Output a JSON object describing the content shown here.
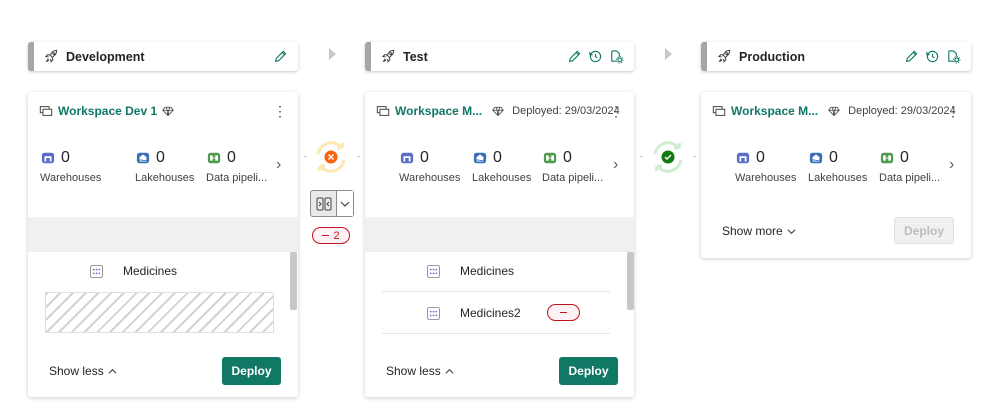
{
  "stages": [
    {
      "title": "Development"
    },
    {
      "title": "Test"
    },
    {
      "title": "Production"
    }
  ],
  "dev": {
    "workspace": "Workspace Dev 1",
    "metrics": [
      {
        "value": "0",
        "label": "Warehouses"
      },
      {
        "value": "0",
        "label": "Lakehouses"
      },
      {
        "value": "0",
        "label": "Data pipeli..."
      }
    ],
    "items": [
      "Medicines"
    ],
    "show_label": "Show less",
    "deploy_label": "Deploy"
  },
  "test": {
    "workspace": "Workspace M...",
    "deployed": "Deployed: 29/03/2024",
    "metrics": [
      {
        "value": "0",
        "label": "Warehouses"
      },
      {
        "value": "0",
        "label": "Lakehouses"
      },
      {
        "value": "0",
        "label": "Data pipeli..."
      }
    ],
    "items": [
      "Medicines",
      "Medicines2"
    ],
    "show_label": "Show less",
    "deploy_label": "Deploy"
  },
  "prod": {
    "workspace": "Workspace M...",
    "deployed": "Deployed: 29/03/2024",
    "metrics": [
      {
        "value": "0",
        "label": "Warehouses"
      },
      {
        "value": "0",
        "label": "Lakehouses"
      },
      {
        "value": "0",
        "label": "Data pipeli..."
      }
    ],
    "show_label": "Show more",
    "deploy_label": "Deploy"
  },
  "compare": {
    "diff_count": "2"
  },
  "colors": {
    "accent": "#117865",
    "diff": "#c50f1f",
    "warn": "#f7630c",
    "ok": "#107c10"
  },
  "icons": [
    "rocket-icon",
    "pencil-icon",
    "history-icon",
    "settings-icon",
    "workspace-icon",
    "diamond-icon",
    "warehouse-icon",
    "lakehouse-icon",
    "pipeline-icon",
    "semantic-model-icon",
    "compare-icon",
    "chevron-down-icon",
    "chevron-right-icon",
    "chevron-up-icon"
  ]
}
